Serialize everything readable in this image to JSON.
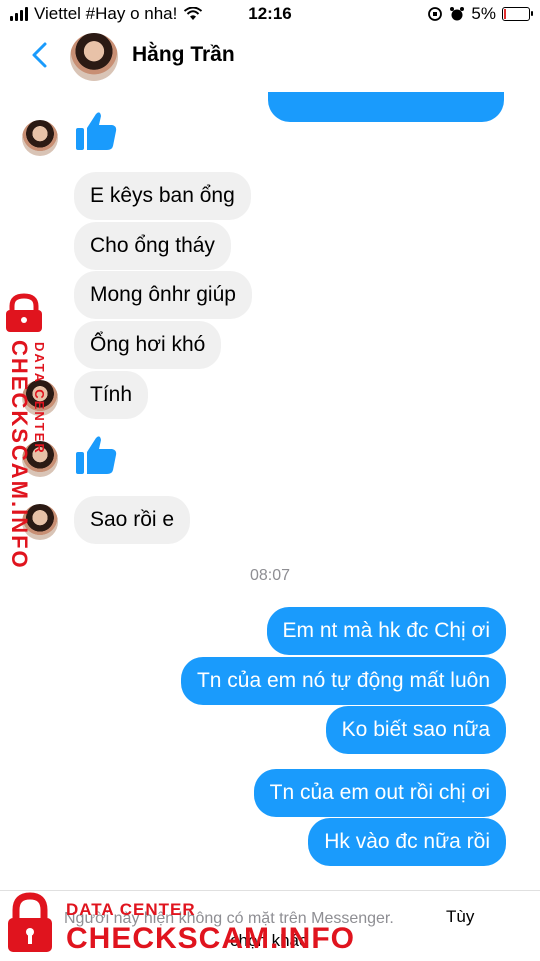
{
  "status_bar": {
    "carrier": "Viettel #Hay o nha!",
    "time": "12:16",
    "battery_percent": "5%",
    "battery_level": 0.05,
    "battery_color": "#e03030"
  },
  "header": {
    "back_icon": "chevron-left-icon",
    "contact_name": "Hằng Trần"
  },
  "messages": {
    "incoming": [
      "E kêys ban ổng",
      "Cho ổng tháy",
      "Mong ônhr giúp",
      "Ổng hơi khó",
      "Tính",
      "Sao rồi e"
    ],
    "timestamp": "08:07",
    "outgoing": [
      "Em nt mà hk đc Chị ơi",
      "Tn của em nó tự động mất luôn",
      "Ko biết sao nữa",
      "Tn của em out rồi chị ơi",
      "Hk vào đc nữa rồi"
    ]
  },
  "footer": {
    "notice": "Người này hiện không có mặt trên Messenger.",
    "action": "Tùy",
    "action_cont": "chọn khác"
  },
  "watermark": {
    "small": "DATA CENTER",
    "big": "CHECKSCAM.INFO",
    "color": "#e0141e"
  },
  "colors": {
    "outgoing_bubble": "#1a9bfc",
    "incoming_bubble": "#f0f0f0",
    "like_icon": "#1a9bfc"
  }
}
